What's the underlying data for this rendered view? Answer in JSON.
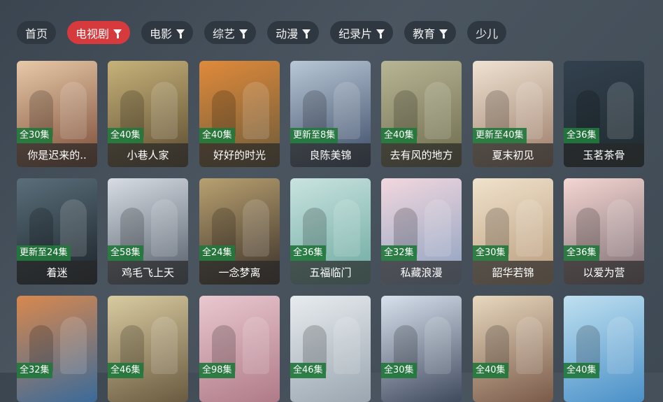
{
  "tabs": [
    {
      "label": "首页",
      "filter": false,
      "active": false
    },
    {
      "label": "电视剧",
      "filter": true,
      "active": true
    },
    {
      "label": "电影",
      "filter": true,
      "active": false
    },
    {
      "label": "综艺",
      "filter": true,
      "active": false
    },
    {
      "label": "动漫",
      "filter": true,
      "active": false
    },
    {
      "label": "纪录片",
      "filter": true,
      "active": false
    },
    {
      "label": "教育",
      "filter": true,
      "active": false
    },
    {
      "label": "少儿",
      "filter": false,
      "active": false
    }
  ],
  "items": [
    {
      "title": "你是迟来的..",
      "badge": "全30集",
      "c1": "#e7c9a8",
      "c2": "#7a4a35"
    },
    {
      "title": "小巷人家",
      "badge": "全40集",
      "c1": "#c7b27a",
      "c2": "#5a4a2e"
    },
    {
      "title": "好好的时光",
      "badge": "全40集",
      "c1": "#e08a3a",
      "c2": "#6b5a3a"
    },
    {
      "title": "良陈美锦",
      "badge": "更新至8集",
      "c1": "#b9c8d6",
      "c2": "#3a4a66"
    },
    {
      "title": "去有风的地方",
      "badge": "全40集",
      "c1": "#b8b595",
      "c2": "#6b6a4a"
    },
    {
      "title": "夏末初见",
      "badge": "更新至40集",
      "c1": "#efe2d2",
      "c2": "#9a7a66"
    },
    {
      "title": "玉茗茶骨",
      "badge": "全36集",
      "c1": "#33414f",
      "c2": "#1e2a2e"
    },
    {
      "title": "着迷",
      "badge": "更新至24集",
      "c1": "#5a6e7a",
      "c2": "#1a2228"
    },
    {
      "title": "鸡毛飞上天",
      "badge": "全58集",
      "c1": "#d8dde4",
      "c2": "#505a66"
    },
    {
      "title": "一念梦离",
      "badge": "全24集",
      "c1": "#b8a070",
      "c2": "#3a3028"
    },
    {
      "title": "五福临门",
      "badge": "全36集",
      "c1": "#c9e3e0",
      "c2": "#6aa89e"
    },
    {
      "title": "私藏浪漫",
      "badge": "全32集",
      "c1": "#f2d7de",
      "c2": "#8aa0c0"
    },
    {
      "title": "韶华若锦",
      "badge": "全30集",
      "c1": "#f0e2cc",
      "c2": "#b89a7a"
    },
    {
      "title": "以爱为营",
      "badge": "全36集",
      "c1": "#f4d6d2",
      "c2": "#7a6a70"
    },
    {
      "title": "",
      "badge": "全32集",
      "c1": "#d9884e",
      "c2": "#3a6a9a"
    },
    {
      "title": "",
      "badge": "全46集",
      "c1": "#d9cba0",
      "c2": "#6a5a40"
    },
    {
      "title": "",
      "badge": "全98集",
      "c1": "#e9c8d0",
      "c2": "#b07a88"
    },
    {
      "title": "",
      "badge": "全46集",
      "c1": "#e8ecef",
      "c2": "#9aa6b0"
    },
    {
      "title": "",
      "badge": "全30集",
      "c1": "#d8e2ee",
      "c2": "#404a5e"
    },
    {
      "title": "",
      "badge": "全40集",
      "c1": "#e8d8c0",
      "c2": "#7a5a48"
    },
    {
      "title": "",
      "badge": "全40集",
      "c1": "#bfe0f0",
      "c2": "#4a90c8"
    }
  ]
}
